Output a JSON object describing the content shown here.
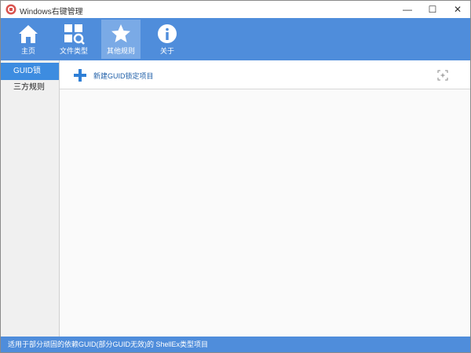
{
  "window": {
    "title": "Windows右键管理",
    "minimize_glyph": "—",
    "maximize_glyph": "☐",
    "close_glyph": "✕"
  },
  "toolbar": {
    "items": [
      {
        "label": "主页",
        "icon": "home-icon",
        "active": false
      },
      {
        "label": "文件类型",
        "icon": "file-type-search-icon",
        "active": false
      },
      {
        "label": "其他规则",
        "icon": "star-icon",
        "active": true
      },
      {
        "label": "关于",
        "icon": "info-icon",
        "active": false
      }
    ]
  },
  "sidebar": {
    "items": [
      {
        "label": "GUID锁",
        "active": true
      },
      {
        "label": "三方规则",
        "active": false
      }
    ]
  },
  "main": {
    "add_label": "新建GUID锁定项目",
    "add_icon": "plus-icon",
    "locate_icon": "locate-icon"
  },
  "status": {
    "text": "适用于部分顽固的依赖GUID(部分GUID无效)的 ShellEx类型项目"
  },
  "colors": {
    "accent": "#4f8ddb",
    "active_tool": "#7aaae6",
    "active_sidebar": "#3d8ce0"
  }
}
